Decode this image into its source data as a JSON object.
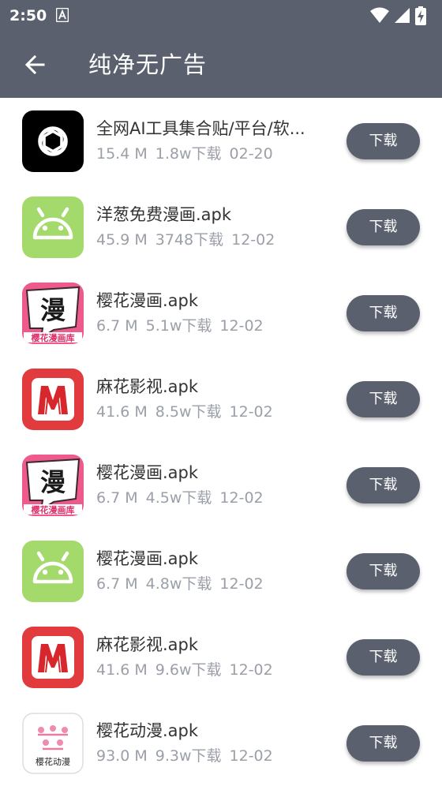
{
  "status_bar": {
    "time": "2:50",
    "icons": [
      "notification-a-icon",
      "wifi-icon",
      "signal-icon",
      "battery-charging-icon"
    ]
  },
  "app_bar": {
    "back_icon": "arrow-left-icon",
    "title": "纯净无广告"
  },
  "colors": {
    "primary": "#5a606d",
    "text": "#333333",
    "meta_text": "#9a9fa8"
  },
  "download_label": "下载",
  "items": [
    {
      "icon": "openai-icon",
      "name": "全网AI工具集合贴/平台/软...",
      "size": "15.4 M",
      "downloads": "1.8w下载",
      "date": "02-20"
    },
    {
      "icon": "android-icon",
      "name": "洋葱免费漫画.apk",
      "size": "45.9 M",
      "downloads": "3748下载",
      "date": "12-02"
    },
    {
      "icon": "sakura-manga-icon",
      "name": "樱花漫画.apk",
      "size": "6.7 M",
      "downloads": "5.1w下载",
      "date": "12-02",
      "icon_text_big": "漫",
      "icon_text_small": "樱花漫画库"
    },
    {
      "icon": "mahua-icon",
      "name": "麻花影视.apk",
      "size": "41.6 M",
      "downloads": "8.5w下载",
      "date": "12-02"
    },
    {
      "icon": "sakura-manga-icon",
      "name": "樱花漫画.apk",
      "size": "6.7 M",
      "downloads": "4.5w下载",
      "date": "12-02",
      "icon_text_big": "漫",
      "icon_text_small": "樱花漫画库"
    },
    {
      "icon": "android-icon",
      "name": "樱花漫画.apk",
      "size": "6.7 M",
      "downloads": "4.8w下载",
      "date": "12-02"
    },
    {
      "icon": "mahua-icon",
      "name": "麻花影视.apk",
      "size": "41.6 M",
      "downloads": "9.6w下载",
      "date": "12-02"
    },
    {
      "icon": "sakura-anime-icon",
      "name": "樱花动漫.apk",
      "size": "93.0 M",
      "downloads": "9.3w下载",
      "date": "12-02",
      "icon_text_small": "樱花动漫"
    }
  ]
}
